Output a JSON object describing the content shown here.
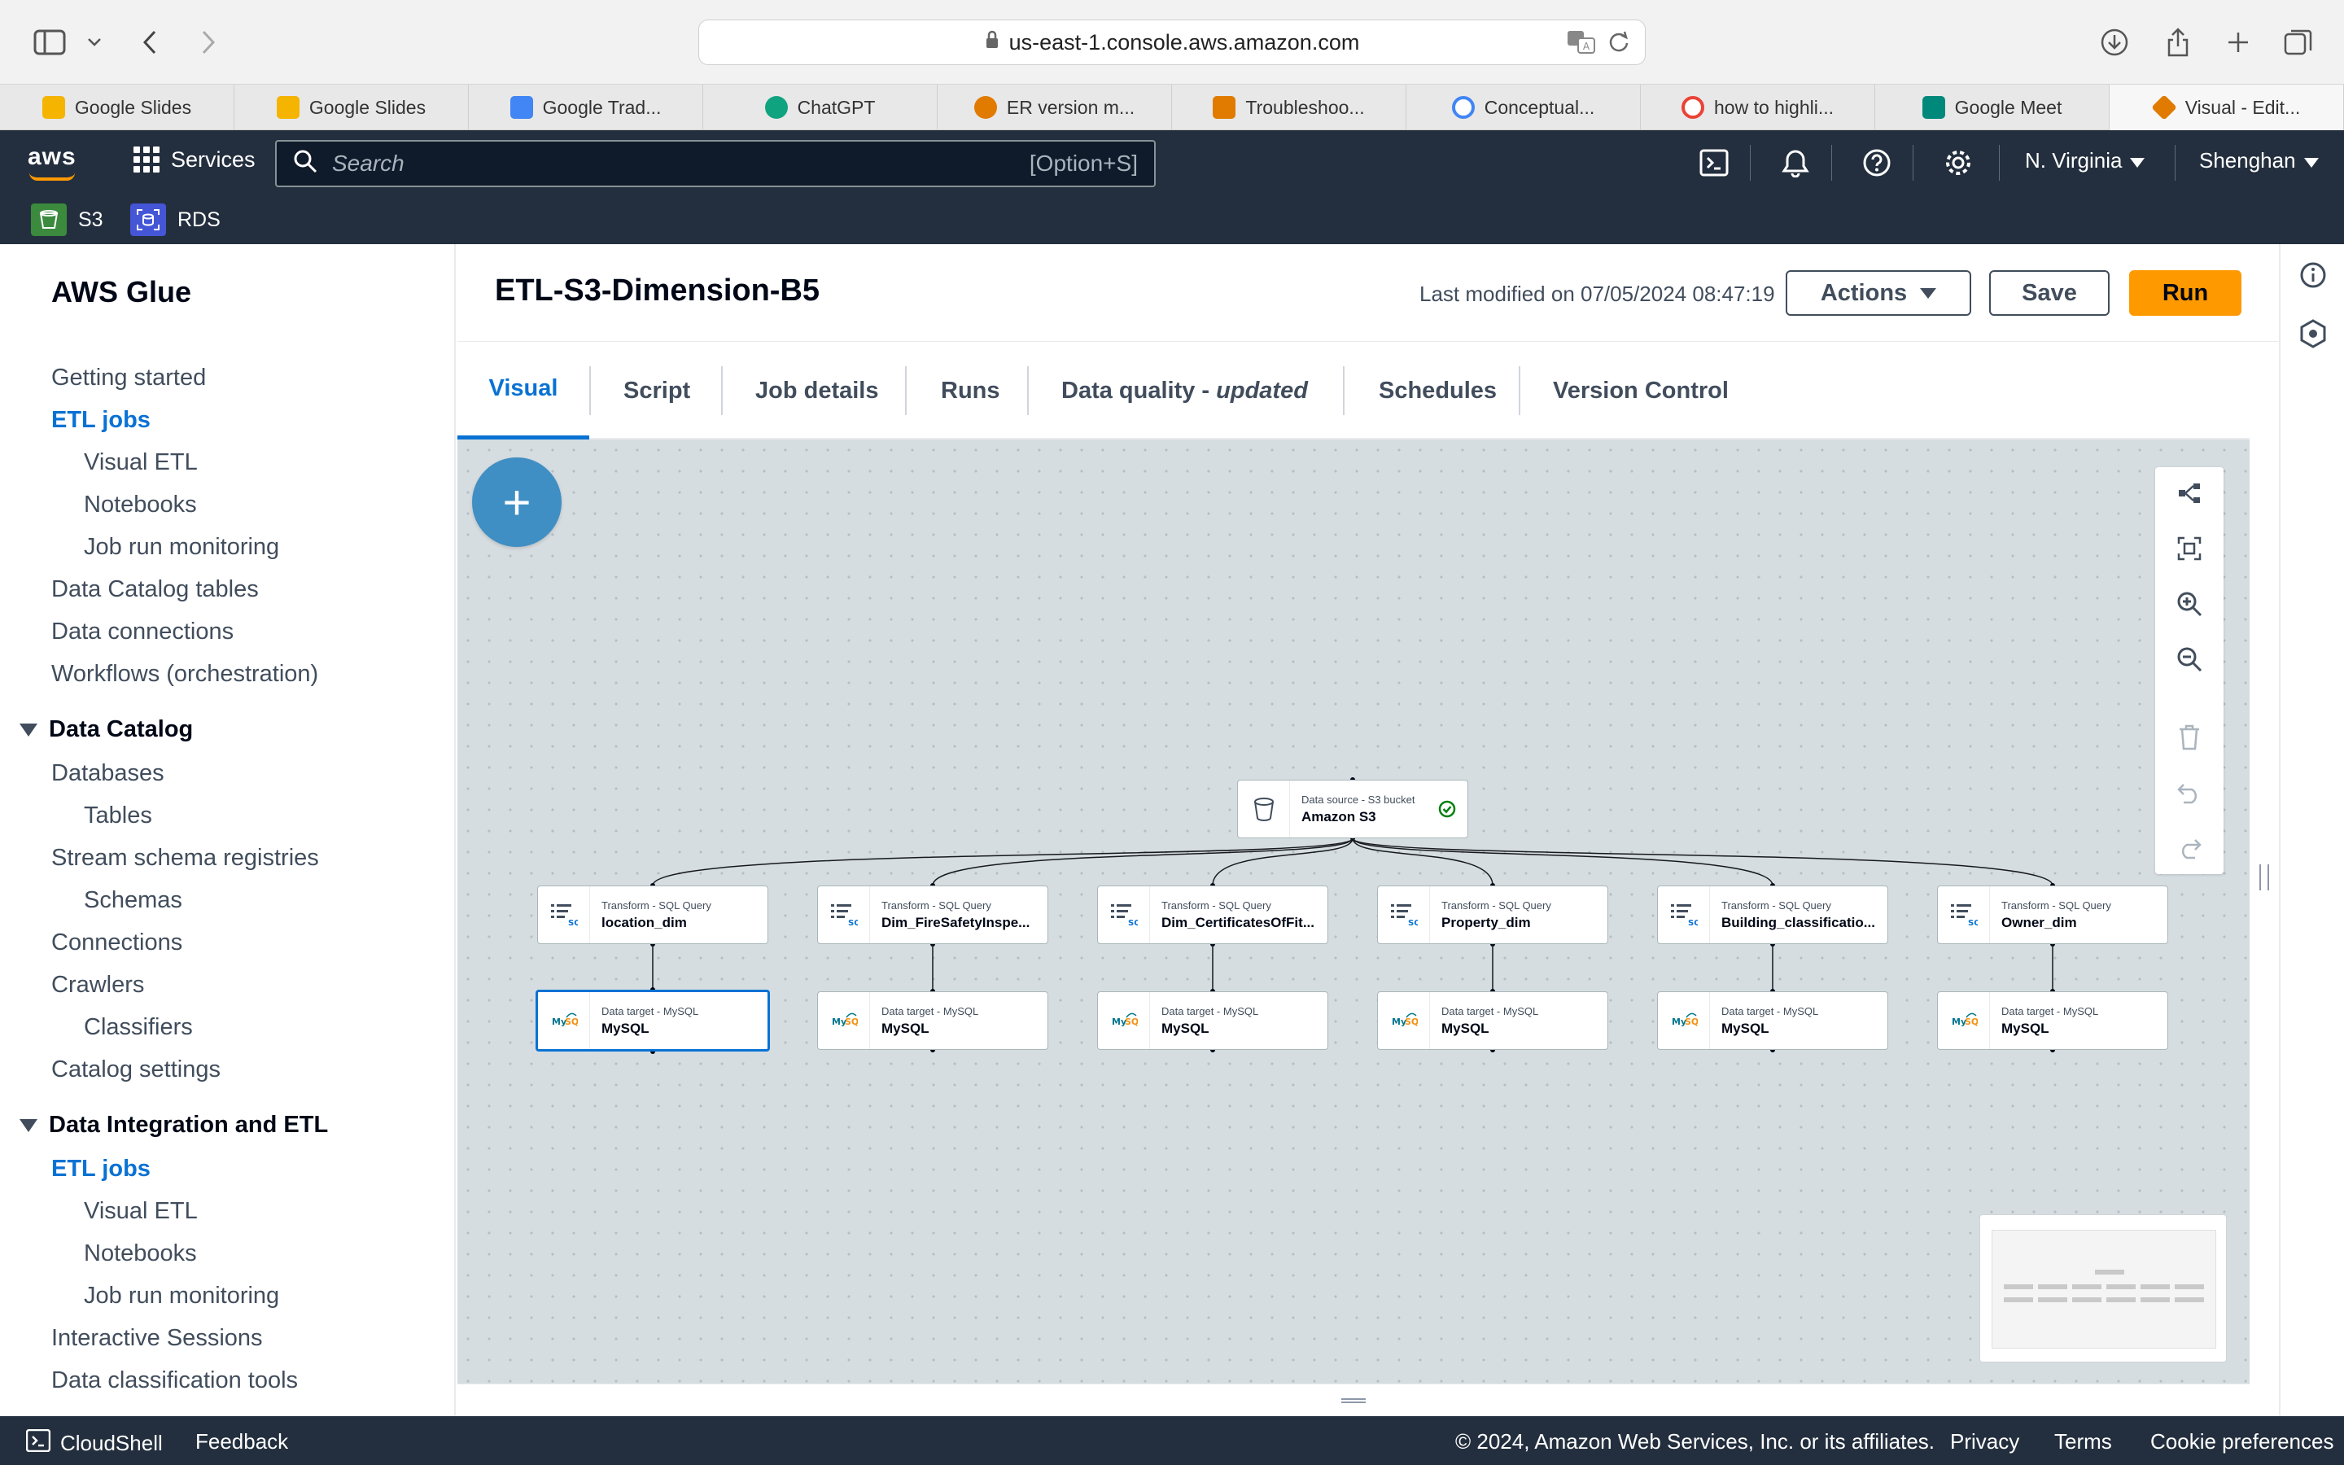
{
  "browser": {
    "url": "us-east-1.console.aws.amazon.com",
    "tabs": [
      {
        "label": "Google Slides",
        "icon": "google-slides-icon",
        "color": "#f4b400"
      },
      {
        "label": "Google Slides",
        "icon": "google-slides-icon",
        "color": "#f4b400"
      },
      {
        "label": "Google Trad...",
        "icon": "google-translate-icon",
        "color": "#4285f4"
      },
      {
        "label": "ChatGPT",
        "icon": "chatgpt-icon",
        "color": "#10a37f"
      },
      {
        "label": "ER version m...",
        "icon": "er-diagram-icon",
        "color": "#e07b00"
      },
      {
        "label": "Troubleshoo...",
        "icon": "diagram-icon",
        "color": "#e07b00"
      },
      {
        "label": "Conceptual...",
        "icon": "google-icon",
        "color": "#4285f4"
      },
      {
        "label": "how to highli...",
        "icon": "google-icon",
        "color": "#4285f4"
      },
      {
        "label": "Google Meet",
        "icon": "google-meet-icon",
        "color": "#00897b"
      },
      {
        "label": "Visual - Edit...",
        "icon": "aws-glue-icon",
        "color": "#e07b00"
      }
    ]
  },
  "aws_nav": {
    "logo": "aws",
    "services_label": "Services",
    "search_placeholder": "Search",
    "search_shortcut": "[Option+S]",
    "region": "N. Virginia",
    "user": "Shenghan",
    "favorites": [
      {
        "label": "S3",
        "color": "#3b8a3e"
      },
      {
        "label": "RDS",
        "color": "#4456d6"
      }
    ]
  },
  "sidebar": {
    "title": "AWS Glue",
    "top_links": [
      "Getting started",
      "ETL jobs",
      "Visual ETL",
      "Notebooks",
      "Job run monitoring",
      "Data Catalog tables",
      "Data connections",
      "Workflows (orchestration)"
    ],
    "data_catalog": {
      "heading": "Data Catalog",
      "links": [
        "Databases",
        "Tables",
        "Stream schema registries",
        "Schemas",
        "Connections",
        "Crawlers",
        "Classifiers",
        "Catalog settings"
      ]
    },
    "data_integration": {
      "heading": "Data Integration and ETL",
      "links": [
        "ETL jobs",
        "Visual ETL",
        "Notebooks",
        "Job run monitoring",
        "Interactive Sessions",
        "Data classification tools"
      ]
    }
  },
  "header": {
    "job_title": "ETL-S3-Dimension-B5",
    "last_modified": "Last modified on 07/05/2024 08:47:19",
    "actions_label": "Actions",
    "save_label": "Save",
    "run_label": "Run"
  },
  "tabs": {
    "visual": "Visual",
    "script": "Script",
    "job_details": "Job details",
    "runs": "Runs",
    "data_quality": "Data quality - ",
    "data_quality_status": "updated",
    "schedules": "Schedules",
    "version_control": "Version Control"
  },
  "canvas": {
    "add_label": "+",
    "source": {
      "type": "Data source - S3 bucket",
      "name": "Amazon S3"
    },
    "transforms": [
      {
        "type": "Transform - SQL Query",
        "name": "location_dim"
      },
      {
        "type": "Transform - SQL Query",
        "name": "Dim_FireSafetyInspe..."
      },
      {
        "type": "Transform - SQL Query",
        "name": "Dim_CertificatesOfFit..."
      },
      {
        "type": "Transform - SQL Query",
        "name": "Property_dim"
      },
      {
        "type": "Transform - SQL Query",
        "name": "Building_classificatio..."
      },
      {
        "type": "Transform - SQL Query",
        "name": "Owner_dim"
      }
    ],
    "targets": [
      {
        "type": "Data target - MySQL",
        "name": "MySQL"
      },
      {
        "type": "Data target - MySQL",
        "name": "MySQL"
      },
      {
        "type": "Data target - MySQL",
        "name": "MySQL"
      },
      {
        "type": "Data target - MySQL",
        "name": "MySQL"
      },
      {
        "type": "Data target - MySQL",
        "name": "MySQL"
      },
      {
        "type": "Data target - MySQL",
        "name": "MySQL"
      }
    ]
  },
  "footer": {
    "cloudshell": "CloudShell",
    "feedback": "Feedback",
    "copyright": "© 2024, Amazon Web Services, Inc. or its affiliates.",
    "privacy": "Privacy",
    "terms": "Terms",
    "cookies": "Cookie preferences"
  },
  "colors": {
    "aws_nav": "#232f3e",
    "accent_orange": "#ff9900",
    "link_blue": "#0972d3",
    "canvas_bg": "#d6dde1"
  }
}
